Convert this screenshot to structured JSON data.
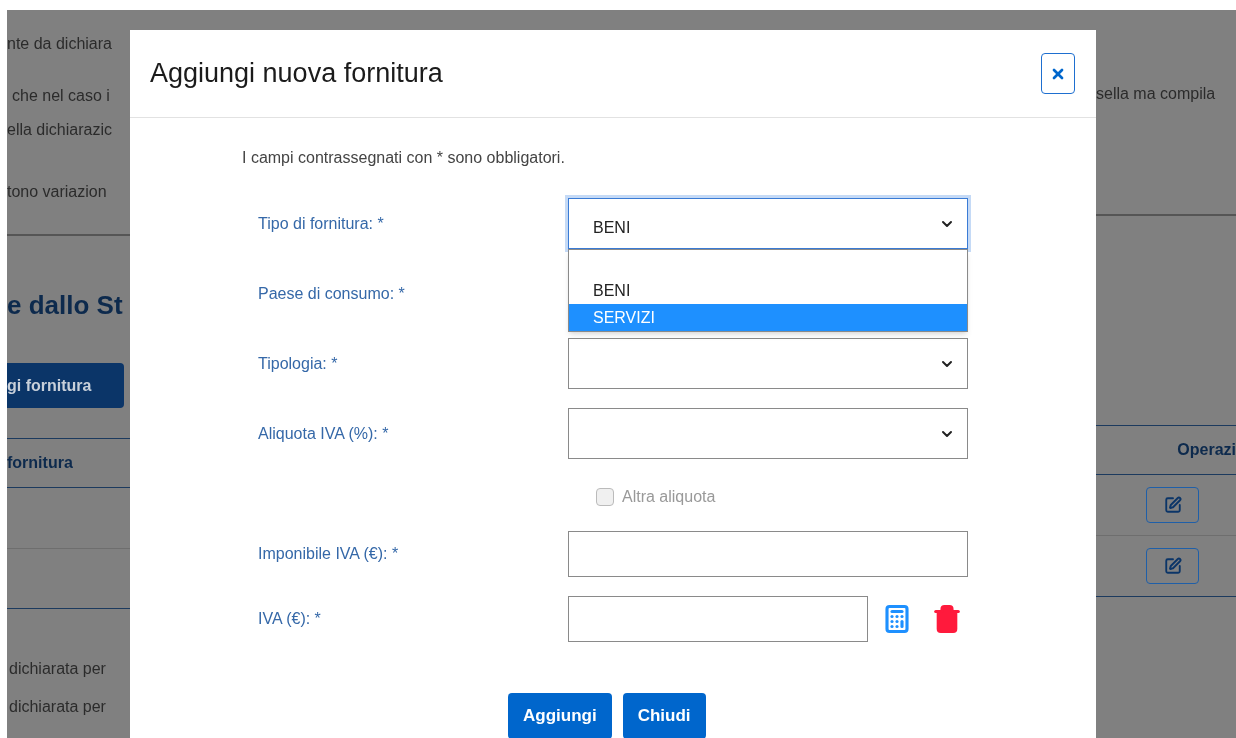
{
  "background": {
    "left_texts": [
      "nte da dichiara",
      "che nel caso i",
      "ella dichiarazic",
      "tono variazion"
    ],
    "left_heading": "e dallo St",
    "left_button": "gi fornitura",
    "left_column_header": "fornitura",
    "left_bottom_texts": [
      "dichiarata per",
      "dichiarata per"
    ],
    "right_text": "sella ma compila",
    "right_column_header": "Operazi"
  },
  "dialog": {
    "title": "Aggiungi nuova fornitura",
    "note": "I campi contrassegnati con * sono obbligatori.",
    "fields": [
      {
        "kind": "select",
        "label": "Tipo di fornitura: *",
        "value": "BENI",
        "focused": true,
        "open": true,
        "options": [
          {
            "label": "BENI",
            "highlighted": false
          },
          {
            "label": "SERVIZI",
            "highlighted": true
          }
        ]
      },
      {
        "kind": "select",
        "label": "Paese di consumo: *",
        "hidden": true
      },
      {
        "kind": "select",
        "label": "Tipologia: *"
      },
      {
        "kind": "select",
        "label": "Aliquota IVA (%): *"
      },
      {
        "kind": "checkbox",
        "label": "Altra aliquota",
        "checked": false,
        "disabled": true
      },
      {
        "kind": "input",
        "label": "Imponibile IVA (€): *"
      },
      {
        "kind": "input_tools",
        "label": "IVA (€): *"
      }
    ],
    "buttons": [
      "Aggiungi",
      "Chiudi"
    ]
  }
}
